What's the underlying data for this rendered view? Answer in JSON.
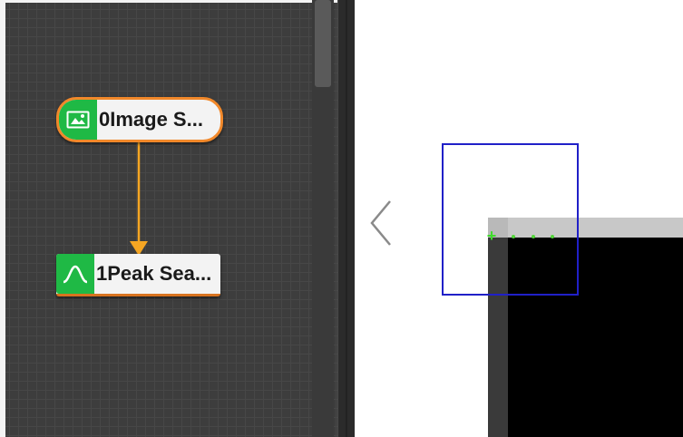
{
  "canvas": {
    "nodes": [
      {
        "label": "0Image S...",
        "icon": "image-icon",
        "type": "image-source"
      },
      {
        "label": "1Peak Sea...",
        "icon": "peak-icon",
        "type": "peak-search"
      }
    ],
    "connection": {
      "from": "0Image S...",
      "to": "1Peak Sea..."
    }
  },
  "colors": {
    "canvas_bg": "#3d3d3d",
    "node_icon_bg": "#1fb945",
    "node_selected_border": "#f1882a",
    "connector": "#f5a623",
    "roi_rect": "#2020c8",
    "marker": "#3fdc2c"
  },
  "image_view": {
    "nav_icon": "chevron-left-icon",
    "marker_icon": "crosshair-plus-icon"
  }
}
